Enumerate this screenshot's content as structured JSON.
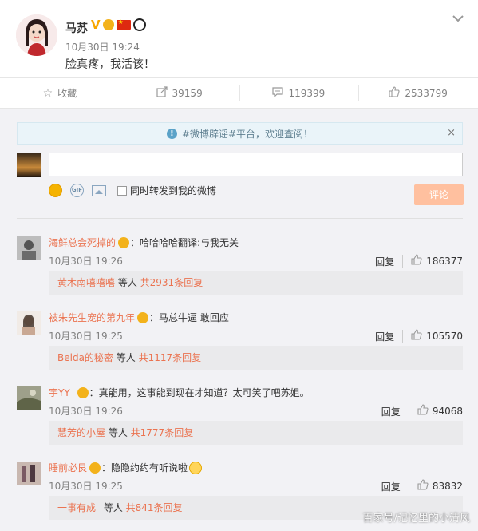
{
  "post": {
    "author": "马苏",
    "time": "10月30日 19:24",
    "text": "脸真疼，我活该！",
    "verified_mark": "V"
  },
  "actions": {
    "favorite": "收藏",
    "repost": "39159",
    "comment": "119399",
    "like": "2533799"
  },
  "notice": {
    "text": "#微博辟谣#平台，欢迎查阅！",
    "close": "×"
  },
  "compose": {
    "input_value": "",
    "sync_label": "同时转发到我的微博",
    "submit": "评论",
    "gif_label": "GIF"
  },
  "comments": [
    {
      "user": "海鲜总会死掉的",
      "text": "：哈哈哈哈翻译:与我无关",
      "time": "10月30日 19:26",
      "reply": "回复",
      "likes": "186377",
      "sub_user": "黄木南嘻嘻嘻",
      "sub_mid": " 等人 ",
      "sub_count": "共2931条回复",
      "avatar_color": "#6b6b6b"
    },
    {
      "user": "被朱先生宠的第九年",
      "text": "：马总牛逼 敢回应",
      "time": "10月30日 19:25",
      "reply": "回复",
      "likes": "105570",
      "sub_user": "Belda的秘密",
      "sub_mid": " 等人 ",
      "sub_count": "共1117条回复",
      "avatar_color": "#c9a893"
    },
    {
      "user": "宇YY_",
      "text": "：真能用，这事能到现在才知道？太可笑了吧苏姐。",
      "time": "10月30日 19:26",
      "reply": "回复",
      "likes": "94068",
      "sub_user": "慧芳的小屋",
      "sub_mid": " 等人 ",
      "sub_count": "共1777条回复",
      "avatar_color": "#7d8263"
    },
    {
      "user": "睡前必艮",
      "text": "：隐隐约约有听说啦",
      "time": "10月30日 19:25",
      "reply": "回复",
      "likes": "83832",
      "sub_user": "一事有成_",
      "sub_mid": " 等人 ",
      "sub_count": "共841条回复",
      "avatar_color": "#7a5a63"
    }
  ],
  "watermark": "百家号/记忆里的小清风",
  "colors": {
    "accent": "#eb7350",
    "muted": "#808080",
    "submit_disabled": "#ffc09f"
  }
}
